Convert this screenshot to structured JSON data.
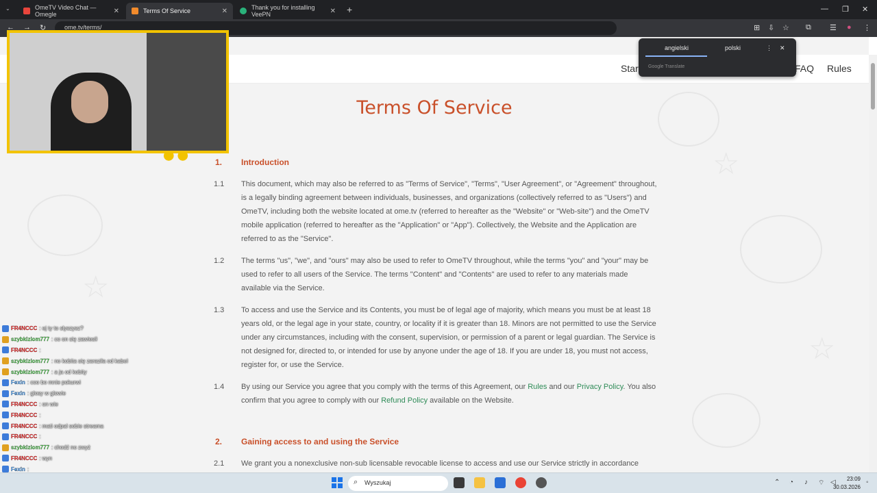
{
  "browser": {
    "tabs": [
      {
        "label": "OmeTV Video Chat — Omegle",
        "color": "#e8453c"
      },
      {
        "label": "Terms Of Service",
        "color": "#f28b2c"
      },
      {
        "label": "Thank you for installing VeePN",
        "color": "#2ab27b"
      }
    ],
    "address": "ome.tv/terms/"
  },
  "translate_popup": {
    "lang_source": "angielski",
    "lang_target": "polski",
    "footer": "Google Translate"
  },
  "nav": {
    "start": "Start",
    "faq": "FAQ",
    "rules": "Rules"
  },
  "page": {
    "title": "Terms Of Service",
    "sections": [
      {
        "num": "1.",
        "title": "Introduction"
      },
      {
        "num": "2.",
        "title": "Gaining access to and using the Service"
      }
    ],
    "paragraphs": {
      "p11_num": "1.1",
      "p11": "This document, which may also be referred to as \"Terms of Service\", \"Terms\", \"User Agreement\", or \"Agreement\" throughout, is a legally binding agreement between individuals, businesses, and organizations (collectively referred to as \"Users\") and OmeTV, including both the website located at ome.tv (referred to hereafter as the \"Website\" or \"Web-site\") and the OmeTV mobile application (referred to hereafter as the \"Application\" or \"App\"). Collectively, the Website and the Application are referred to as the \"Service\".",
      "p12_num": "1.2",
      "p12": "The terms \"us\", \"we\", and \"ours\" may also be used to refer to OmeTV throughout, while the terms \"you\" and \"your\" may be used to refer to all users of the Service. The terms \"Content\" and \"Contents\" are used to refer to any materials made available via the Service.",
      "p13_num": "1.3",
      "p13": "To access and use the Service and its Contents, you must be of legal age of majority, which means you must be at least 18 years old, or the legal age in your state, country, or locality if it is greater than 18. Minors are not permitted to use the Service under any circumstances, including with the consent, supervision, or permission of a parent or legal guardian. The Service is not designed for, directed to, or intended for use by anyone under the age of 18. If you are under 18, you must not access, register for, or use the Service.",
      "p14_num": "1.4",
      "p14_a": "By using our Service you agree that you comply with the terms of this Agreement, our ",
      "p14_link_rules": "Rules",
      "p14_b": " and our ",
      "p14_link_privacy": "Privacy Policy",
      "p14_c": ". You also confirm that you agree to comply with our ",
      "p14_link_refund": "Refund Policy",
      "p14_d": " available on the Website.",
      "p21_num": "2.1",
      "p21": "We grant you a nonexclusive non-sub licensable revocable license to access and use our Service strictly in accordance"
    }
  },
  "chat": [
    {
      "user": "FR4NCCC",
      "color": "#ff3030",
      "msg": ": ej ty to słyszysz?"
    },
    {
      "user": "szybkiziom777",
      "color": "#5cd65c",
      "msg": ": co on się  zawiesił"
    },
    {
      "user": "FR4NCCC",
      "color": "#ff3030",
      "msg": ":"
    },
    {
      "user": "szybkiziom777",
      "color": "#5cd65c",
      "msg": ": no kobita się zaraziła od kabel"
    },
    {
      "user": "szybkiziom777",
      "color": "#5cd65c",
      "msg": ": a ja od kobity"
    },
    {
      "user": "Fexin",
      "color": "#4da6ff",
      "msg": ": coo  bo mnie pokurwi"
    },
    {
      "user": "Fexin",
      "color": "#4da6ff",
      "msg": ": głosy w głowie"
    },
    {
      "user": "FR4NCCC",
      "color": "#ff3030",
      "msg": ": on  wie"
    },
    {
      "user": "FR4NCCC",
      "color": "#ff3030",
      "msg": ":"
    },
    {
      "user": "FR4NCCC",
      "color": "#ff3030",
      "msg": ": mati odpal sobie streama"
    },
    {
      "user": "FR4NCCC",
      "color": "#ff3030",
      "msg": ":"
    },
    {
      "user": "szybkiziom777",
      "color": "#5cd65c",
      "msg": ": chodź no zwyż"
    },
    {
      "user": "FR4NCCC",
      "color": "#ff3030",
      "msg": ": wyn"
    },
    {
      "user": "Fexin",
      "color": "#4da6ff",
      "msg": ":"
    },
    {
      "user": "FR4NCCC",
      "color": "#ff3030",
      "msg": ":"
    }
  ],
  "taskbar": {
    "search_placeholder": "Wyszukaj",
    "time": "23:09",
    "date": "30.03.2026"
  }
}
